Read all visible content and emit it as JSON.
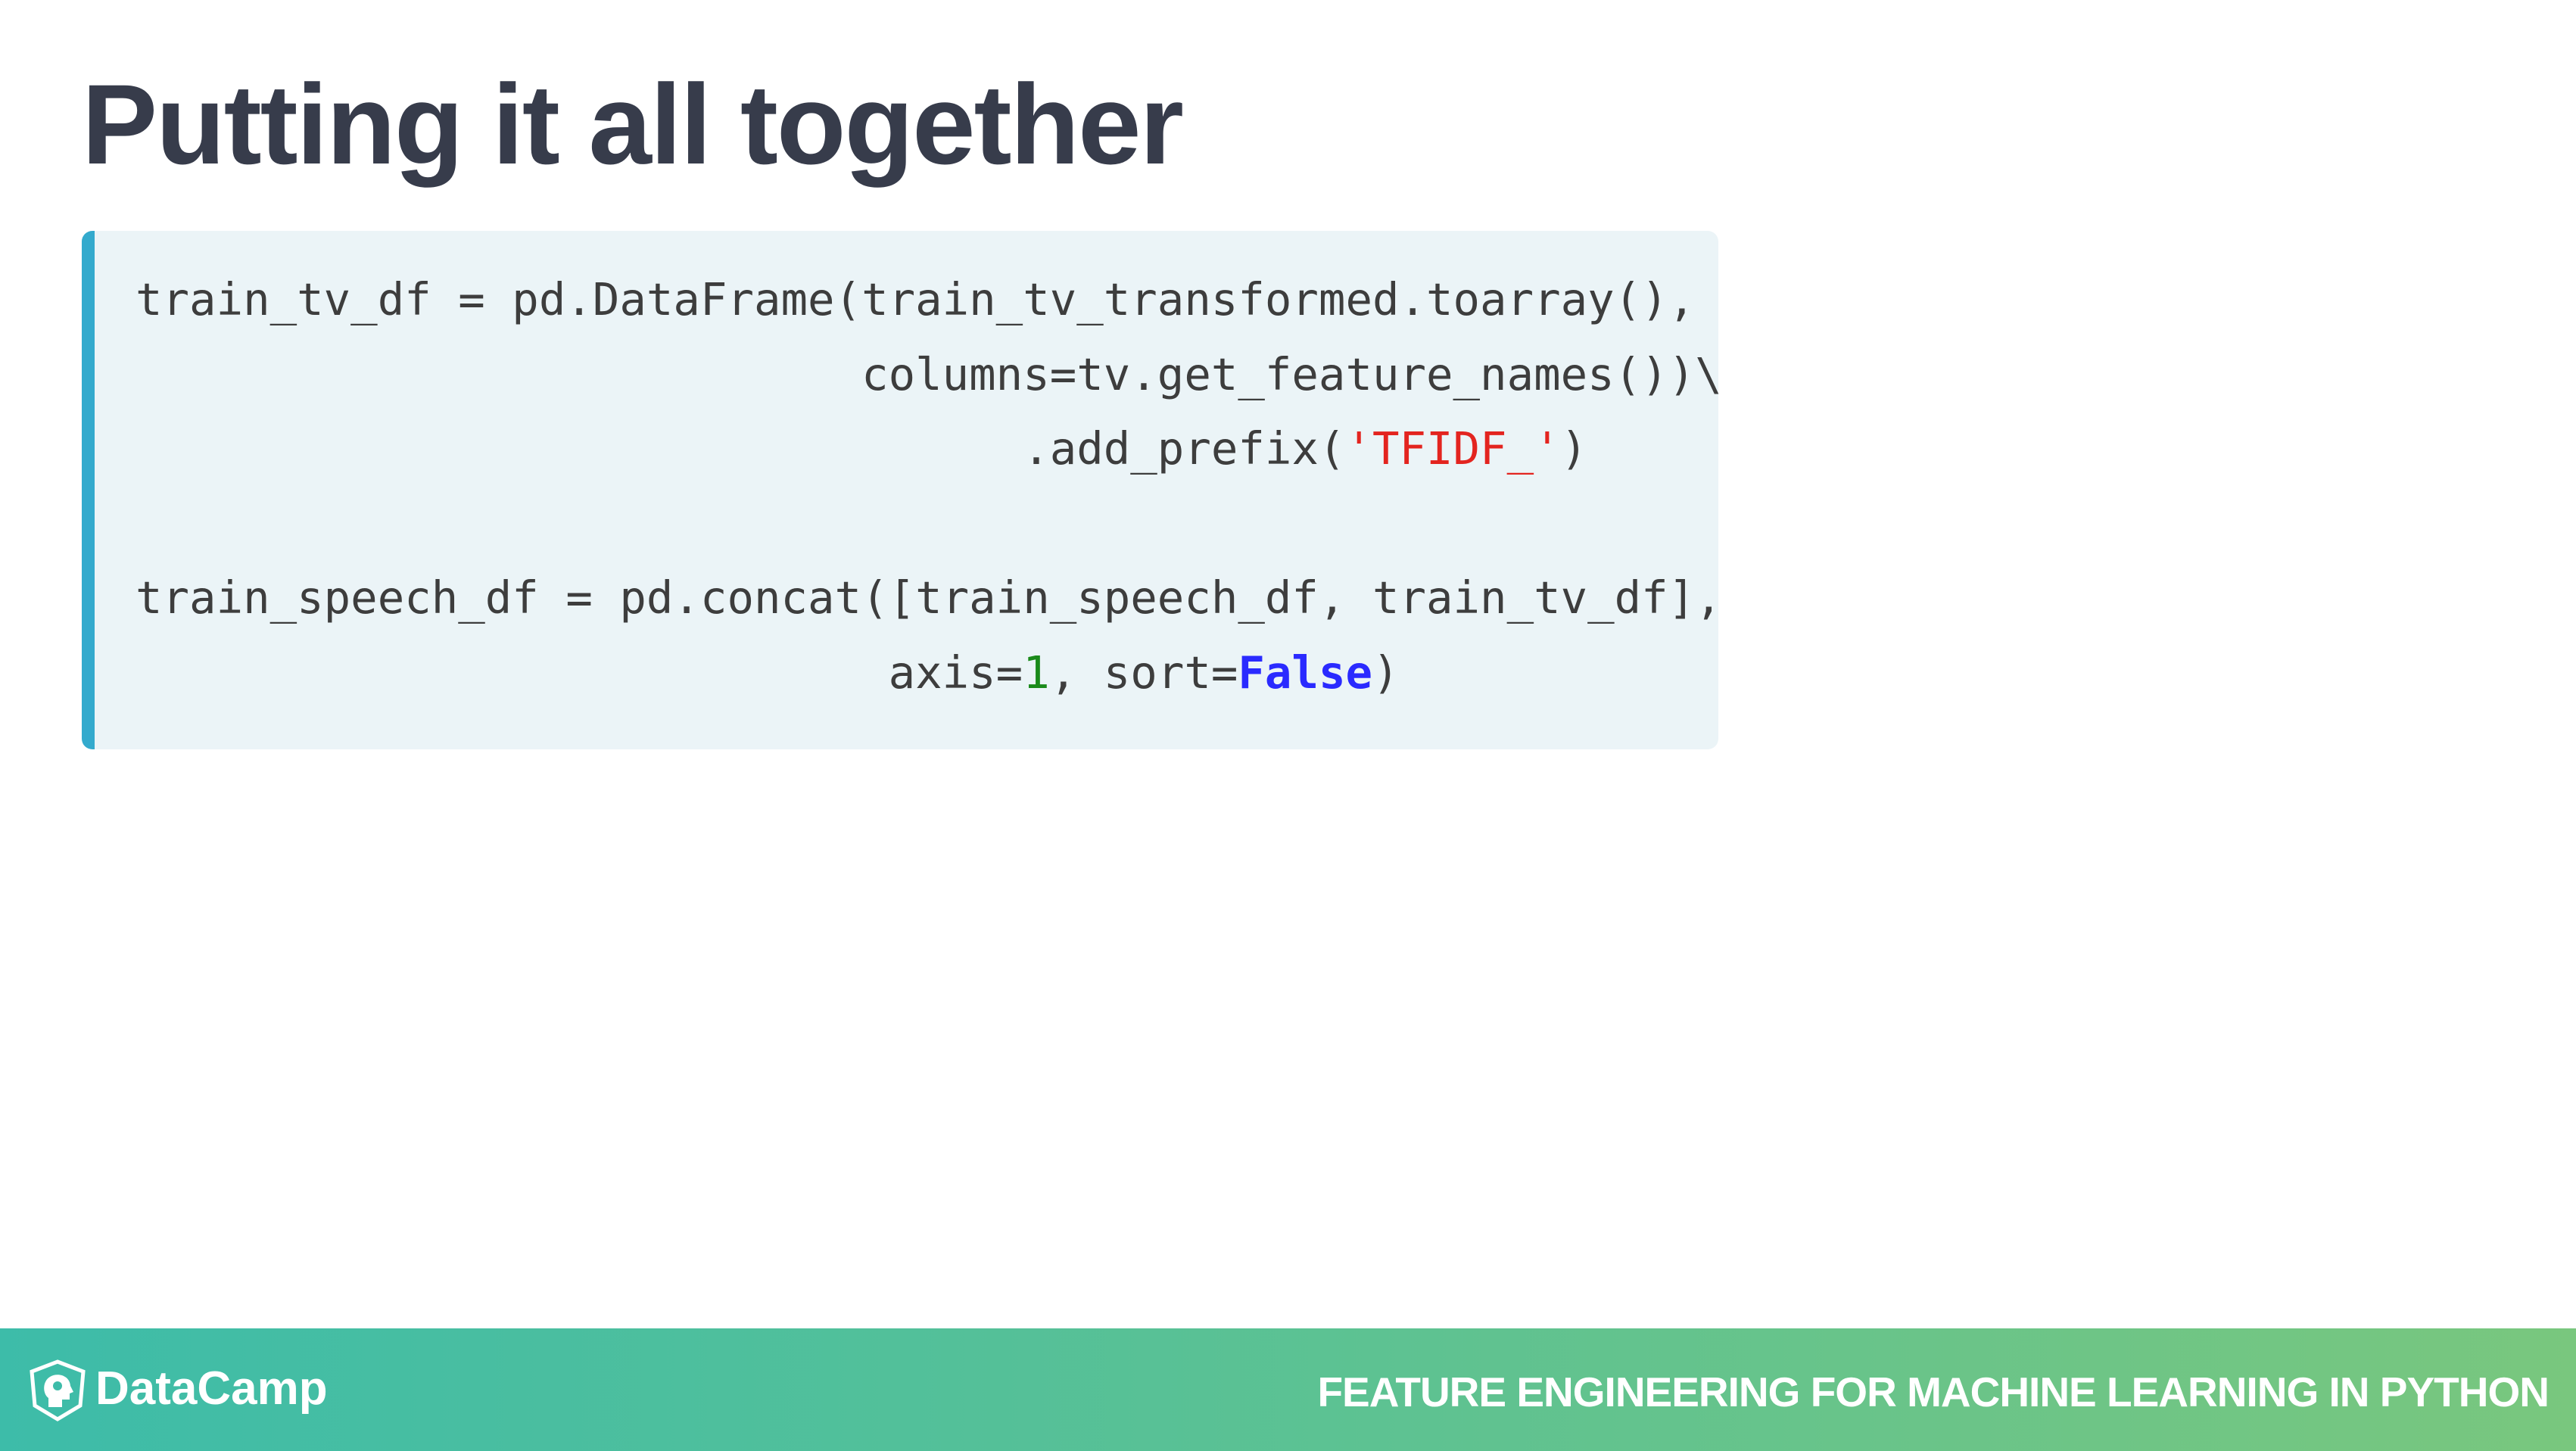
{
  "slide": {
    "title": "Putting it all together"
  },
  "code": {
    "lines": [
      [
        {
          "t": "train_tv_df = pd.DataFrame(train_tv_transformed.toarray(),",
          "c": ""
        }
      ],
      [
        {
          "t": "                           columns=tv.get_feature_names())\\",
          "c": ""
        }
      ],
      [
        {
          "t": "                                 .add_prefix(",
          "c": ""
        },
        {
          "t": "'TFIDF_'",
          "c": "str"
        },
        {
          "t": ")",
          "c": ""
        }
      ],
      [
        {
          "t": "",
          "c": ""
        }
      ],
      [
        {
          "t": "train_speech_df = pd.concat([train_speech_df, train_tv_df],",
          "c": ""
        }
      ],
      [
        {
          "t": "                            axis=",
          "c": ""
        },
        {
          "t": "1",
          "c": "num"
        },
        {
          "t": ", sort=",
          "c": ""
        },
        {
          "t": "False",
          "c": "kw"
        },
        {
          "t": ")",
          "c": ""
        }
      ]
    ],
    "colors": {
      "string": "#e3241f",
      "number": "#1a8a1a",
      "keyword": "#2a2aff",
      "accent_bar": "#33aacd"
    }
  },
  "footer": {
    "brand": "DataCamp",
    "logo_icon": "datacamp-head-shield-icon",
    "course": "FEATURE ENGINEERING FOR MACHINE LEARNING IN PYTHON"
  }
}
